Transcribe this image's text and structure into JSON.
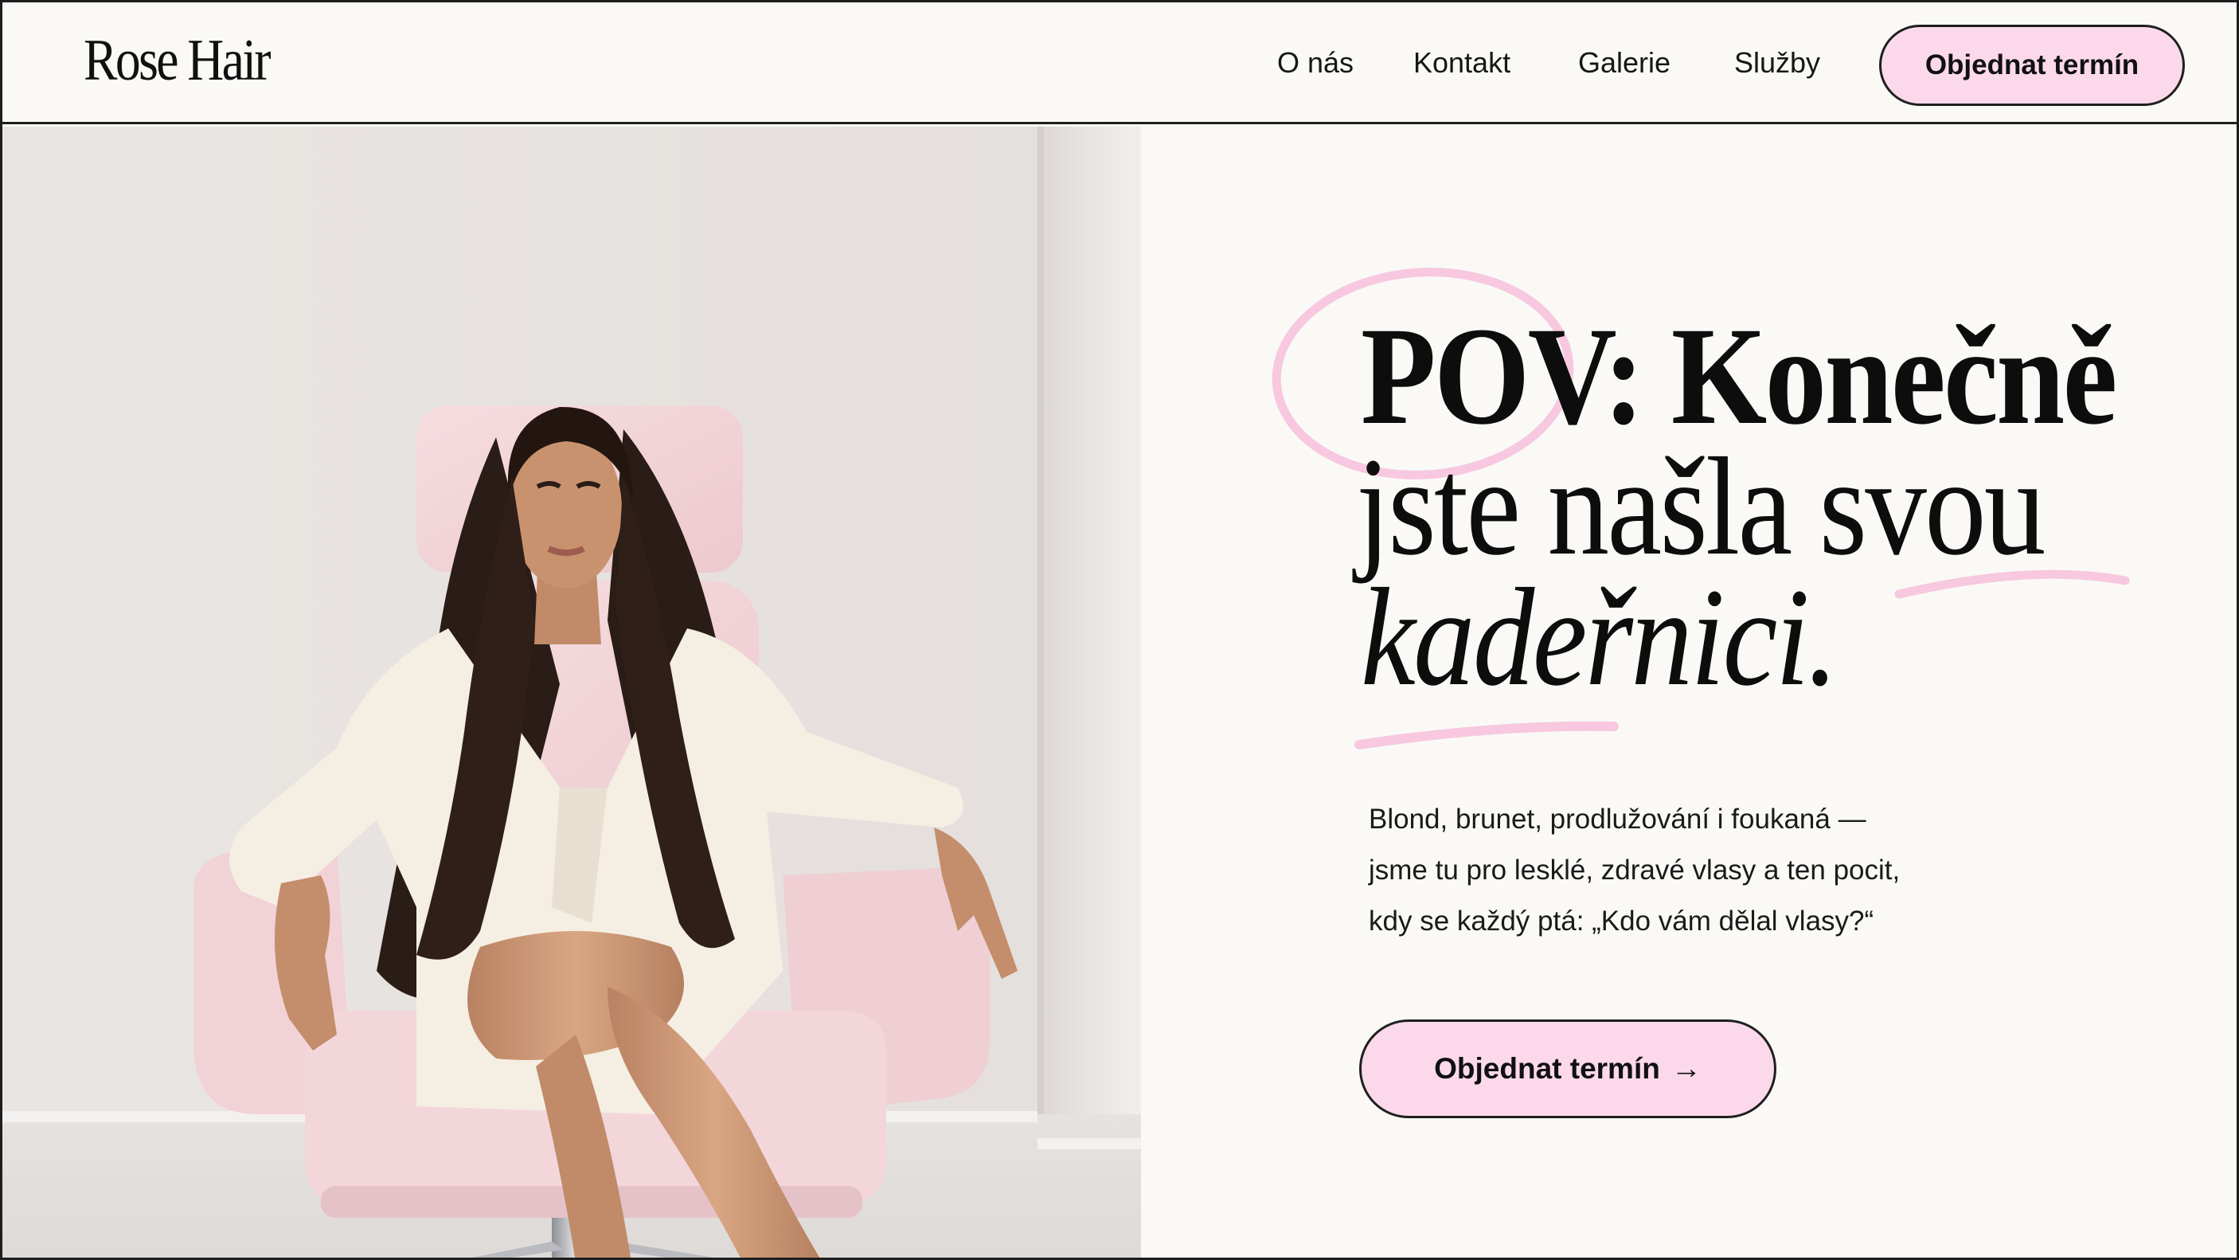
{
  "brand": {
    "logo_text": "Rose Hair"
  },
  "nav": {
    "items": [
      {
        "label": "O nás"
      },
      {
        "label": "Kontakt"
      },
      {
        "label": "Galerie"
      },
      {
        "label": "Služby"
      }
    ],
    "cta_label": "Objednat termín"
  },
  "hero": {
    "headline": {
      "line1": "POV: Konečně",
      "line2": "jste našla svou",
      "line3": "kadeřnici."
    },
    "description": [
      "Blond, brunet, prodlužování i foukaná —",
      "jsme tu pro lesklé, zdravé vlasy a ten pocit,",
      "kdy se každý ptá: „Kdo vám dělal vlasy?“"
    ],
    "cta_label": "Objednat termín",
    "cta_icon": "arrow-right-icon",
    "cta_arrow_glyph": "→"
  },
  "colors": {
    "accent_pink": "#fbd9ea",
    "highlight_pink": "#f7c8e0",
    "background": "#faf9f6",
    "text": "#111111",
    "border": "#1e1e1e"
  }
}
